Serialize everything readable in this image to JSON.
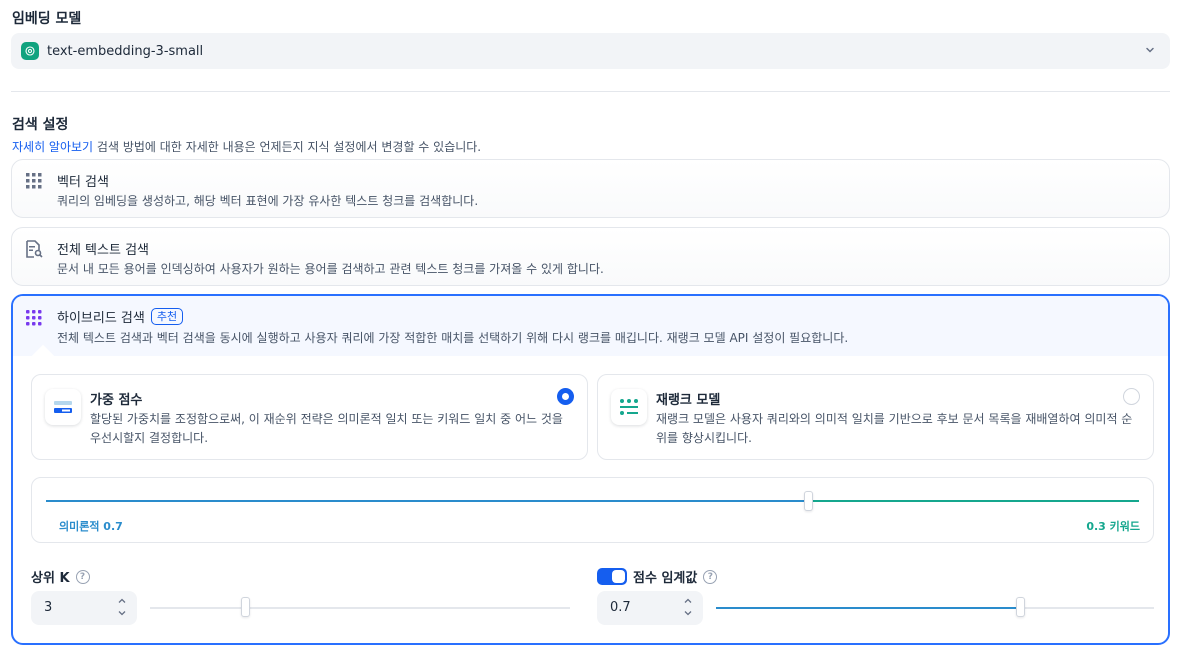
{
  "embedding": {
    "label": "임베딩 모델",
    "selected_model": "text-embedding-3-small",
    "model_icon": "openai-icon"
  },
  "search_settings": {
    "label": "검색 설정",
    "learn_more": "자세히 알아보기",
    "help_text": " 검색 방법에 대한 자세한 내용은 언제든지 지식 설정에서 변경할 수 있습니다."
  },
  "methods": {
    "vector": {
      "title": "벡터 검색",
      "desc": "쿼리의 임베딩을 생성하고, 해당 벡터 표현에 가장 유사한 텍스트 청크를 검색합니다."
    },
    "fulltext": {
      "title": "전체 텍스트 검색",
      "desc": "문서 내 모든 용어를 인덱싱하여 사용자가 원하는 용어를 검색하고 관련 텍스트 청크를 가져올 수 있게 합니다."
    },
    "hybrid": {
      "title": "하이브리드 검색",
      "badge": "추천",
      "desc": "전체 텍스트 검색과 벡터 검색을 동시에 실행하고 사용자 쿼리에 가장 적합한 매치를 선택하기 위해 다시 랭크를 매깁니다. 재랭크 모델 API 설정이 필요합니다.",
      "options": {
        "weighted": {
          "title": "가중 점수",
          "desc": "할당된 가중치를 조정함으로써, 이 재순위 전략은 의미론적 일치 또는 키워드 일치 중 어느 것을 우선시할지 결정합니다.",
          "selected": true
        },
        "rerank": {
          "title": "재랭크 모델",
          "desc": "재랭크 모델은 사용자 쿼리와의 의미적 일치를 기반으로 후보 문서 목록을 재배열하여 의미적 순위를 향상시킵니다.",
          "selected": false
        }
      },
      "weights": {
        "semantic_label": "의미론적 0.7",
        "keyword_label": "0.3 키워드",
        "semantic": 0.7,
        "keyword": 0.3
      },
      "top_k": {
        "label": "상위 K",
        "value": "3",
        "help": "?",
        "slider_fraction": 0.2
      },
      "score_threshold": {
        "label": "점수 임계값",
        "value": "0.7",
        "help": "?",
        "enabled": true,
        "slider_fraction": 0.7
      }
    }
  },
  "colors": {
    "accent": "#155eef",
    "semantic": "#2a8ccc",
    "keyword": "#15a78e",
    "border_selected": "#2970ff"
  }
}
